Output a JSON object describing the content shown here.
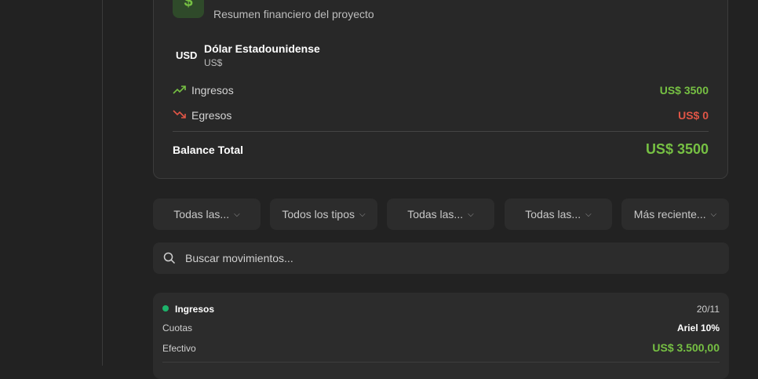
{
  "summary": {
    "icon": "dollar-icon",
    "subtitle": "Resumen financiero del proyecto",
    "currency_code": "USD",
    "currency_name": "Dólar Estadounidense",
    "currency_symbol": "US$",
    "income_label": "Ingresos",
    "income_value": "US$ 3500",
    "expense_label": "Egresos",
    "expense_value": "US$ 0",
    "balance_label": "Balance Total",
    "balance_value": "US$ 3500",
    "colors": {
      "positive": "#76c043",
      "negative": "#e05546"
    }
  },
  "filters": [
    {
      "label": "Todas las..."
    },
    {
      "label": "Todos los tipos"
    },
    {
      "label": "Todas las..."
    },
    {
      "label": "Todas las..."
    },
    {
      "label": "Más reciente..."
    }
  ],
  "search": {
    "placeholder": "Buscar movimientos..."
  },
  "movement": {
    "type": "Ingresos",
    "date": "20/11",
    "category": "Cuotas",
    "person": "Ariel 10%",
    "method": "Efectivo",
    "amount": "US$ 3.500,00",
    "dot_color": "#1db36b"
  }
}
